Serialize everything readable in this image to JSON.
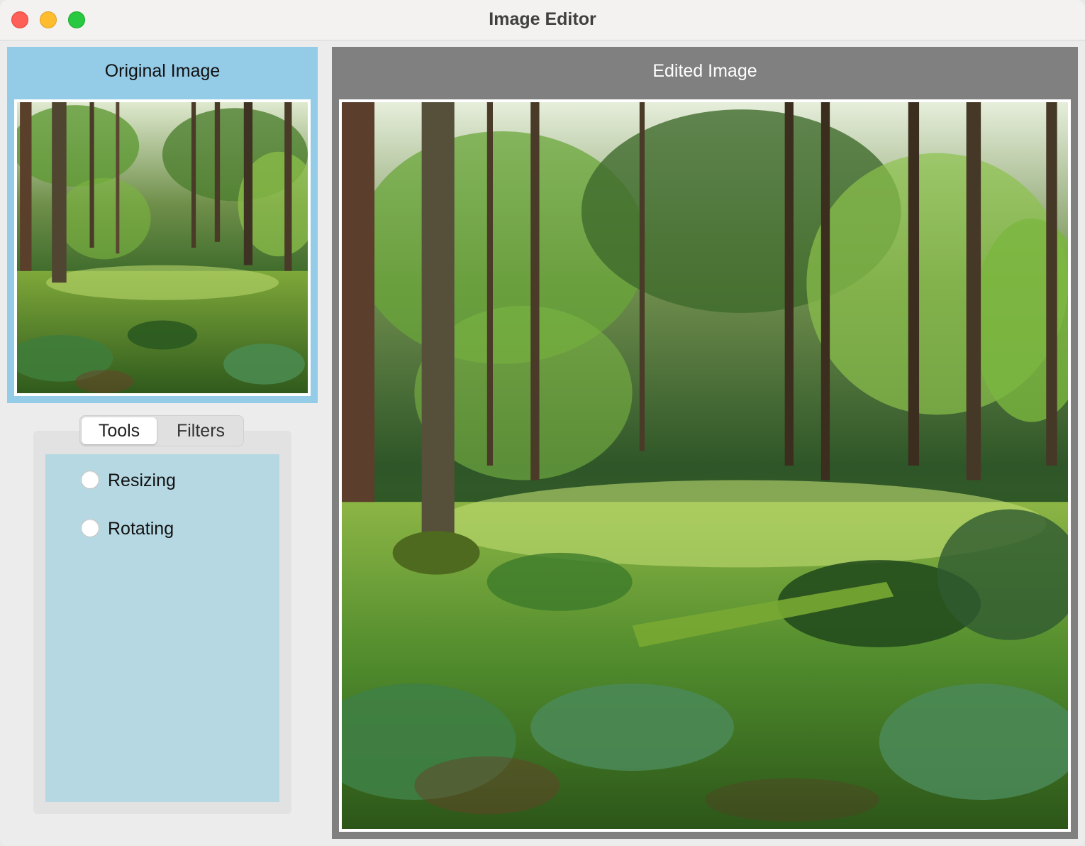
{
  "window": {
    "title": "Image Editor"
  },
  "original_panel": {
    "title": "Original Image",
    "image": "forest-scene",
    "accent_color": "#94cbe7"
  },
  "edited_panel": {
    "title": "Edited Image",
    "image": "forest-scene",
    "accent_color": "#808080"
  },
  "tabs": [
    {
      "label": "Tools",
      "selected": true
    },
    {
      "label": "Filters",
      "selected": false
    }
  ],
  "tools": {
    "options": [
      {
        "label": "Resizing",
        "checked": false
      },
      {
        "label": "Rotating",
        "checked": false
      }
    ],
    "background_color": "#b6d8e3"
  }
}
